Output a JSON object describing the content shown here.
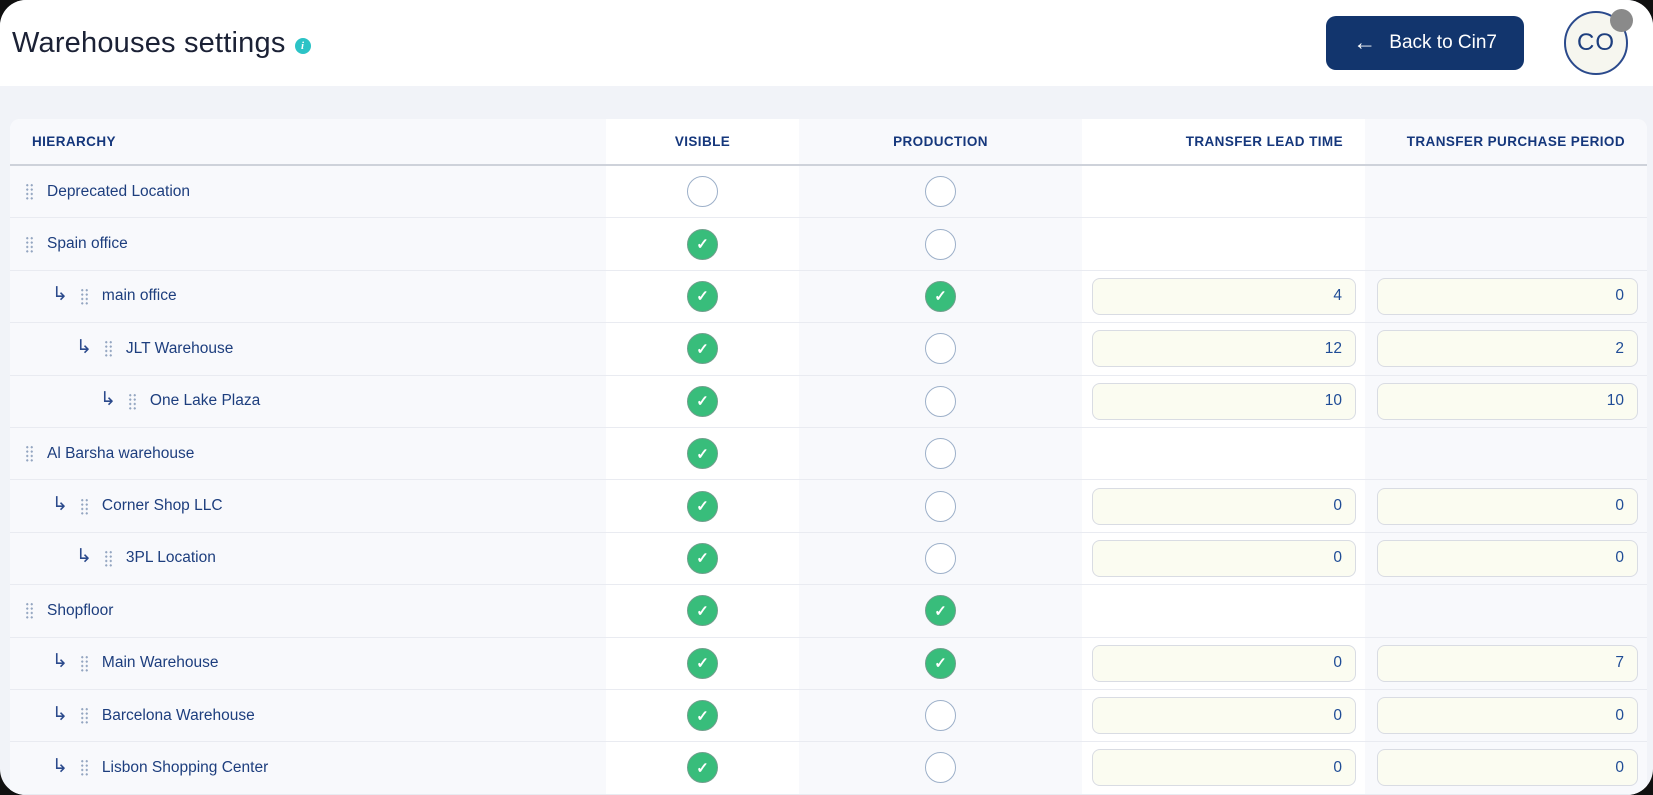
{
  "header": {
    "title": "Warehouses settings",
    "back_button": {
      "arrow": "←",
      "label": "Back to Cin7"
    },
    "avatar": {
      "initials": "CO"
    }
  },
  "table": {
    "columns": [
      {
        "key": "hierarchy",
        "label": "HIERARCHY"
      },
      {
        "key": "visible",
        "label": "VISIBLE"
      },
      {
        "key": "production",
        "label": "PRODUCTION"
      },
      {
        "key": "lead",
        "label": "TRANSFER LEAD TIME"
      },
      {
        "key": "purchase",
        "label": "TRANSFER PURCHASE PERIOD"
      }
    ],
    "rows": [
      {
        "name": "Deprecated Location",
        "level": 0,
        "visible": false,
        "production": false,
        "lead": null,
        "purchase": null
      },
      {
        "name": "Spain office",
        "level": 0,
        "visible": true,
        "production": false,
        "lead": null,
        "purchase": null
      },
      {
        "name": "main office",
        "level": 1,
        "visible": true,
        "production": true,
        "lead": "4",
        "purchase": "0"
      },
      {
        "name": "JLT Warehouse",
        "level": 2,
        "visible": true,
        "production": false,
        "lead": "12",
        "purchase": "2"
      },
      {
        "name": "One Lake Plaza",
        "level": 3,
        "visible": true,
        "production": false,
        "lead": "10",
        "purchase": "10"
      },
      {
        "name": "Al Barsha warehouse",
        "level": 0,
        "visible": true,
        "production": false,
        "lead": null,
        "purchase": null
      },
      {
        "name": "Corner Shop LLC",
        "level": 1,
        "visible": true,
        "production": false,
        "lead": "0",
        "purchase": "0"
      },
      {
        "name": "3PL Location",
        "level": 2,
        "visible": true,
        "production": false,
        "lead": "0",
        "purchase": "0"
      },
      {
        "name": "Shopfloor",
        "level": 0,
        "visible": true,
        "production": true,
        "lead": null,
        "purchase": null
      },
      {
        "name": "Main Warehouse",
        "level": 1,
        "visible": true,
        "production": true,
        "lead": "0",
        "purchase": "7"
      },
      {
        "name": "Barcelona Warehouse",
        "level": 1,
        "visible": true,
        "production": false,
        "lead": "0",
        "purchase": "0"
      },
      {
        "name": "Lisbon Shopping Center",
        "level": 1,
        "visible": true,
        "production": false,
        "lead": "0",
        "purchase": "0"
      }
    ]
  },
  "colors": {
    "accent_navy": "#15377c",
    "button_navy": "#12356d",
    "green_check": "#38bd7b",
    "teal_info": "#2cc3c6",
    "input_cream": "#fbfcf1",
    "page_background": "#f1f3f8",
    "column_stripe": "#f8f9fc"
  }
}
